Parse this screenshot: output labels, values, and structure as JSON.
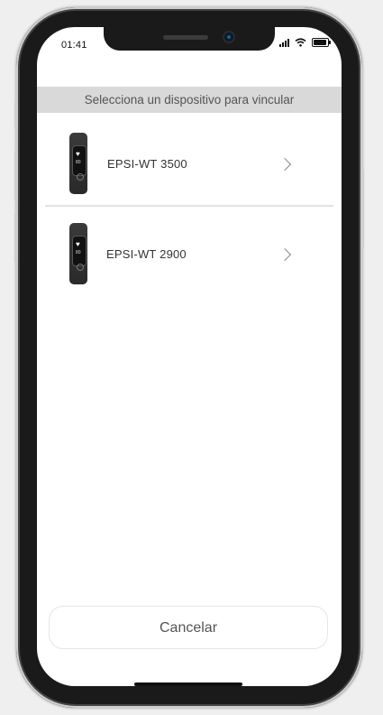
{
  "status_bar": {
    "time": "01:41"
  },
  "header": {
    "title": "Selecciona un dispositivo para vincular"
  },
  "devices": [
    {
      "name": "EPSI-WT 3500",
      "icon": "fitness-band-icon",
      "badge": "80"
    },
    {
      "name": "EPSI-WT 2900",
      "icon": "fitness-band-icon",
      "badge": "80"
    }
  ],
  "footer": {
    "cancel_label": "Cancelar"
  },
  "colors": {
    "header_bg": "#d9d9d9",
    "screen_bg": "#ffffff",
    "frame": "#1a1a1a",
    "text": "#333333"
  }
}
